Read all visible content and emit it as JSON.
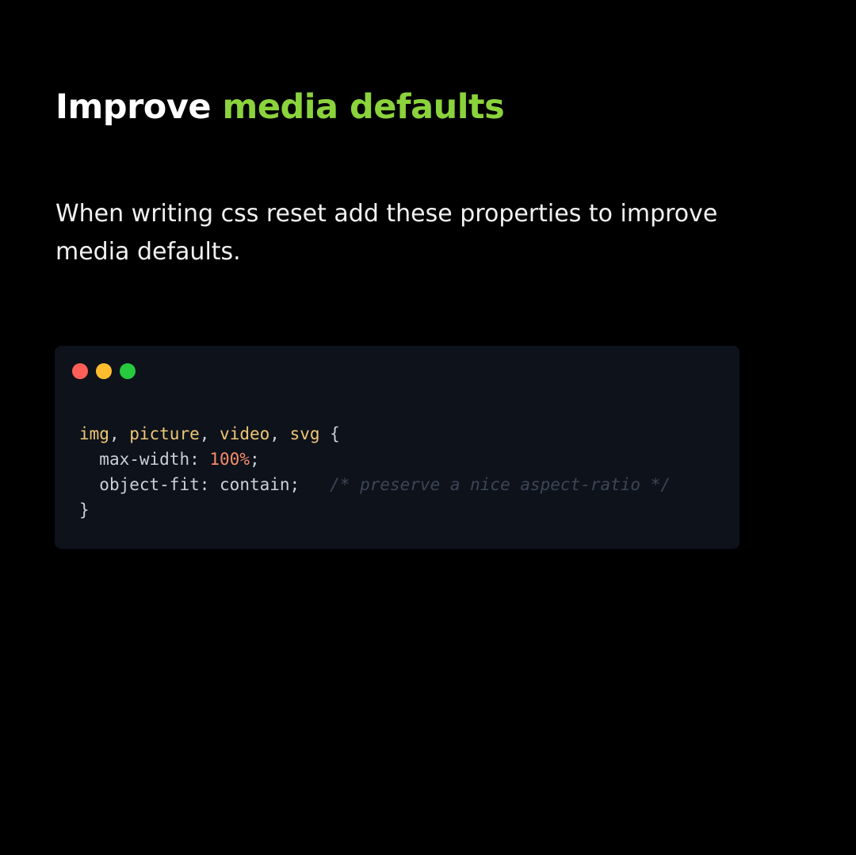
{
  "title": {
    "plain": "Improve",
    "accent": "media defaults"
  },
  "description": "When writing css reset add these properties to improve media defaults.",
  "code_window": {
    "dots": [
      {
        "name": "close-dot",
        "color": "#ff5f56"
      },
      {
        "name": "minimize-dot",
        "color": "#ffbd2e"
      },
      {
        "name": "maximize-dot",
        "color": "#27c93f"
      }
    ],
    "code": {
      "line1": {
        "selector1": "img",
        "sep1": ", ",
        "selector2": "picture",
        "sep2": ", ",
        "selector3": "video",
        "sep3": ", ",
        "selector4": "svg",
        "open_brace": " {"
      },
      "line2": {
        "indent": "  ",
        "property": "max-width",
        "colon": ": ",
        "value": "100%",
        "semicolon": ";"
      },
      "line3": {
        "indent": "  ",
        "property": "object-fit",
        "colon": ": ",
        "value": "contain",
        "semicolon": ";",
        "gap": "   ",
        "comment": "/* preserve a nice aspect-ratio */"
      },
      "line4": {
        "close_brace": "}"
      }
    }
  },
  "colors": {
    "background": "#000000",
    "accent": "#8bd33c",
    "code_background": "#0d121b",
    "selector": "#f0c674",
    "number": "#f78c6c",
    "comment": "#3d4656"
  }
}
